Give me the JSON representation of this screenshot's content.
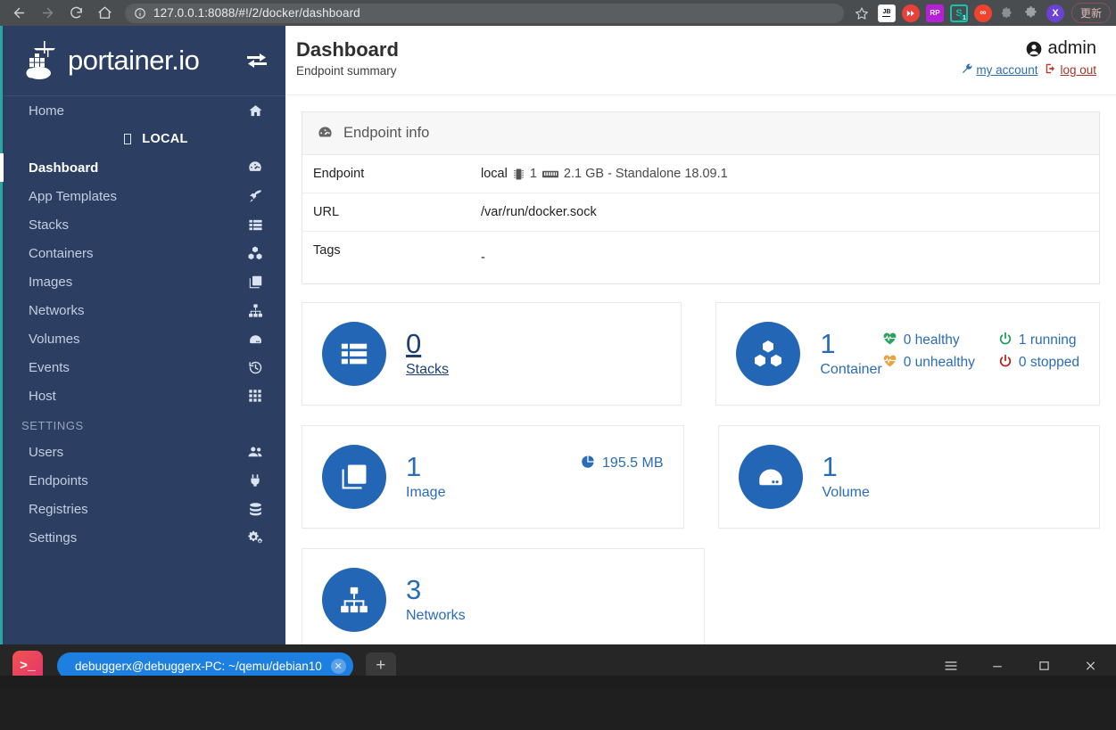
{
  "browser": {
    "back_icon": "back-arrow-icon",
    "forward_icon": "forward-arrow-icon",
    "reload_icon": "reload-icon",
    "home_icon": "home-icon",
    "url": "127.0.0.1:8088/#!/2/docker/dashboard",
    "url_host": "127.0.0.1:8088",
    "url_path": "/#!/2/docker/dashboard",
    "site_info_icon": "info-circle-icon",
    "bookmark_icon": "star-icon",
    "extensions": [
      {
        "name": "jetbrains-extension-icon",
        "label": "JB"
      },
      {
        "name": "youtube-extension-icon",
        "label": ""
      },
      {
        "name": "rp-extension-icon",
        "label": "RP"
      },
      {
        "name": "s-extension-icon",
        "label": "S",
        "badge": "1"
      },
      {
        "name": "infinity-extension-icon",
        "label": "∞"
      },
      {
        "name": "gear-extension-icon",
        "label": ""
      },
      {
        "name": "puzzle-extension-icon",
        "label": ""
      },
      {
        "name": "x-extension-icon",
        "label": "X"
      }
    ],
    "update_label": "更新"
  },
  "sidebar": {
    "logo_text": "portainer.io",
    "toggle_icon": "collapse-sidebar-icon",
    "home": {
      "label": "Home",
      "icon": "home-icon"
    },
    "endpoint_badge": {
      "label": "LOCAL",
      "icon": "endpoint-box-icon"
    },
    "items": [
      {
        "label": "Dashboard",
        "icon": "dashboard-icon",
        "active": true
      },
      {
        "label": "App Templates",
        "icon": "rocket-icon",
        "active": false
      },
      {
        "label": "Stacks",
        "icon": "list-icon",
        "active": false
      },
      {
        "label": "Containers",
        "icon": "containers-icon",
        "active": false
      },
      {
        "label": "Images",
        "icon": "images-icon",
        "active": false
      },
      {
        "label": "Networks",
        "icon": "network-icon",
        "active": false
      },
      {
        "label": "Volumes",
        "icon": "volume-icon",
        "active": false
      },
      {
        "label": "Events",
        "icon": "history-icon",
        "active": false
      },
      {
        "label": "Host",
        "icon": "grid-icon",
        "active": false
      }
    ],
    "settings_heading": "SETTINGS",
    "settings_items": [
      {
        "label": "Users",
        "icon": "users-icon"
      },
      {
        "label": "Endpoints",
        "icon": "plug-icon"
      },
      {
        "label": "Registries",
        "icon": "database-icon"
      },
      {
        "label": "Settings",
        "icon": "gears-icon"
      }
    ]
  },
  "header": {
    "title": "Dashboard",
    "subtitle": "Endpoint summary",
    "user": "admin",
    "user_icon": "user-circle-icon",
    "my_account_label": "my account",
    "my_account_icon": "wrench-icon",
    "log_out_label": "log out",
    "log_out_icon": "logout-icon"
  },
  "endpoint_info": {
    "panel_title": "Endpoint info",
    "panel_icon": "dashboard-icon",
    "rows": [
      {
        "key": "Endpoint",
        "value": "local",
        "cpu_icon": "cpu-icon",
        "cpu": "1",
        "memory_icon": "memory-icon",
        "memory": "2.1 GB - Standalone 18.09.1"
      },
      {
        "key": "URL",
        "value": "/var/run/docker.sock"
      },
      {
        "key": "Tags",
        "value": "-"
      }
    ]
  },
  "cards": [
    {
      "name": "stacks",
      "icon": "list-icon",
      "count": "0",
      "label": "Stacks",
      "is_link": true
    },
    {
      "name": "containers",
      "icon": "containers-icon",
      "count": "1",
      "label": "Container",
      "is_link": false,
      "stats": [
        {
          "icon": "heartbeat-green-icon",
          "text": "0 healthy",
          "color": "#27a35c"
        },
        {
          "icon": "power-green-icon",
          "text": "1 running",
          "color": "#1b9e57"
        },
        {
          "icon": "heartbeat-orange-icon",
          "text": "0 unhealthy",
          "color": "#e8a33d"
        },
        {
          "icon": "power-red-icon",
          "text": "0 stopped",
          "color": "#b52017"
        }
      ]
    },
    {
      "name": "images",
      "icon": "images-icon",
      "count": "1",
      "label": "Image",
      "is_link": false,
      "size_icon": "pie-chart-icon",
      "size": "195.5 MB"
    },
    {
      "name": "volumes",
      "icon": "volume-icon",
      "count": "1",
      "label": "Volume",
      "is_link": false
    },
    {
      "name": "networks",
      "icon": "network-icon",
      "count": "3",
      "label": "Networks",
      "is_link": false
    }
  ],
  "taskbar": {
    "app_icon": "terminal-icon",
    "tab_title": "debuggerx@debuggerx-PC: ~/qemu/debian10",
    "tab_close_icon": "close-icon",
    "new_tab_icon": "plus-icon",
    "menu_icon": "hamburger-menu-icon",
    "minimize_icon": "minimize-icon",
    "maximize_icon": "maximize-icon",
    "close_icon": "close-icon"
  },
  "colors": {
    "sidebar_bg": "#2c3e62",
    "accent_teal": "#2aa5a0",
    "card_circle": "#2266b5",
    "link_blue": "#2b6cb8",
    "link_navy": "#1e3f73",
    "taskbar_tab": "#1d7fe0"
  }
}
